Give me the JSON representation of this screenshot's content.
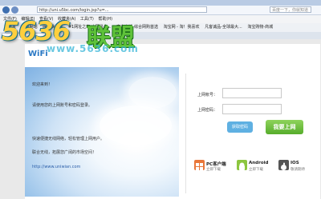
{
  "browser": {
    "url": "http://uni.u5bc.com/login.jsp?u=...",
    "search_placeholder": "百度一下，你就知道",
    "menu": [
      "文件(F)",
      "编辑(E)",
      "查看(V)",
      "收藏夹(A)",
      "工具(T)",
      "帮助(H)"
    ],
    "favorites": [
      "收藏夹",
      "建议网站",
      "网页快讯库",
      "#1网址之家 中国最多...",
      "京东商城-综合网购首选",
      "淘宝网 - 淘！我喜欢",
      "凡客诚品-全球最大...",
      "淘宝购物-商城"
    ],
    "tab_title": "..."
  },
  "watermark": {
    "logo": "5636",
    "logo_cn": "联盟",
    "url": "www.5636.com"
  },
  "page": {
    "logo": "WiFi",
    "welcome": "欢迎来到！",
    "line1": "请使用您的上网账号和密码登录。",
    "line2": "快速便捷无线网络，轻松管理上网用户。",
    "line3": "联合无线，拓展您广阔的市场空间！",
    "website": "http://www.uniwian.com"
  },
  "login": {
    "account_label": "上网帐号：",
    "password_label": "上网密码：",
    "captcha_label": "获取密码",
    "submit_label": "我要上网"
  },
  "downloads": [
    {
      "title": "PC客户端",
      "sub": "立即下载"
    },
    {
      "title": "Android",
      "sub": "立即下载"
    },
    {
      "title": "IOS",
      "sub": "敬请期待"
    }
  ]
}
